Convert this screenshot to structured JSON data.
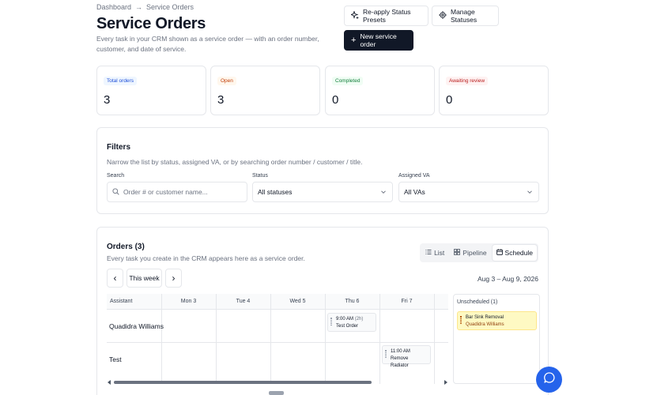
{
  "breadcrumb": {
    "root": "Dashboard",
    "sep": "→",
    "current": "Service Orders"
  },
  "header": {
    "title": "Service Orders",
    "subtitle": "Every task in your CRM shown as a service order — with an order number, customer, and date of service.",
    "reapply_label": "Re-apply Status Presets",
    "manage_label": "Manage Statuses",
    "new_label": "New service order"
  },
  "stats": [
    {
      "label": "Total orders",
      "value": "3",
      "bg": "#eff6ff",
      "fg": "#1d4ed8"
    },
    {
      "label": "Open",
      "value": "3",
      "bg": "#fff7ed",
      "fg": "#c2410c"
    },
    {
      "label": "Completed",
      "value": "0",
      "bg": "#f0fdf4",
      "fg": "#15803d"
    },
    {
      "label": "Awaiting review",
      "value": "0",
      "bg": "#fef2f2",
      "fg": "#b91c1c"
    }
  ],
  "filters": {
    "title": "Filters",
    "subtitle": "Narrow the list by status, assigned VA, or by searching order number / customer / title.",
    "search_label": "Search",
    "search_placeholder": "Order # or customer name...",
    "status_label": "Status",
    "status_value": "All statuses",
    "va_label": "Assigned VA",
    "va_value": "All VAs"
  },
  "orders": {
    "title": "Orders (3)",
    "subtitle": "Every task you create in the CRM appears here as a service order.",
    "views": {
      "list": "List",
      "pipeline": "Pipeline",
      "schedule": "Schedule",
      "active": "schedule"
    },
    "prev_label": "‹",
    "week_label": "This week",
    "next_label": "›",
    "range_label": "Aug 3 – Aug 9, 2026",
    "columns": [
      "Assistant",
      "Mon 3",
      "Tue 4",
      "Wed 5",
      "Thu 6",
      "Fri 7"
    ],
    "rows": [
      {
        "assistant": "Quadidra Williams",
        "event": {
          "day": "Thu 6",
          "time": "9:00 AM",
          "duration": "(2h)",
          "title": "Test Order"
        }
      },
      {
        "assistant": "Test",
        "event": {
          "day": "Fri 7",
          "time": "11:00 AM",
          "duration": "",
          "title": "Remove Radiator"
        }
      }
    ],
    "unscheduled": {
      "title": "Unscheduled (1)",
      "items": [
        {
          "title": "Bar Sink Removal",
          "assignee": "Quadidra Williams"
        }
      ]
    }
  },
  "icons": {
    "reapply": "sparkle-icon",
    "manage": "gear-icon",
    "new": "plus-icon",
    "search": "search-icon",
    "list": "list-icon",
    "pipeline": "kanban-icon",
    "schedule": "calendar-icon",
    "chat": "chat-bubble-icon"
  },
  "colors": {
    "primary_button": "#111827",
    "chat_button": "#2563eb",
    "unscheduled_card": "#fef9c3"
  }
}
